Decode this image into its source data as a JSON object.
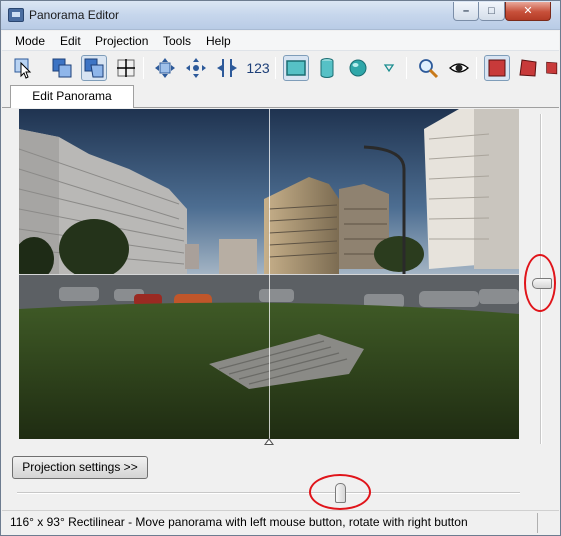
{
  "window": {
    "title": "Panorama Editor"
  },
  "menu": {
    "items": [
      "Mode",
      "Edit",
      "Projection",
      "Tools",
      "Help"
    ]
  },
  "toolbar": {
    "buttons": [
      {
        "icon": "select-arrow-icon"
      },
      {
        "icon": "overlapping-frames-icon"
      },
      {
        "icon": "overlapping-frames-selected-icon",
        "pressed": true
      },
      {
        "icon": "crosshair-icon"
      },
      {
        "icon": "move-all-directions-icon"
      },
      {
        "icon": "move-center-icon"
      },
      {
        "icon": "compress-horizontal-icon"
      },
      {
        "icon": "numbering-icon",
        "label": "123"
      },
      {
        "icon": "rectilinear-projection-icon",
        "pressed": true
      },
      {
        "icon": "cylinder-projection-icon"
      },
      {
        "icon": "sphere-projection-icon"
      },
      {
        "icon": "dropdown-triangle-icon"
      },
      {
        "icon": "zoom-icon"
      },
      {
        "icon": "eye-icon"
      },
      {
        "icon": "frame-red-square-icon",
        "pressed": true
      },
      {
        "icon": "frame-red-skew-icon"
      },
      {
        "icon": "frame-red-partial-icon"
      }
    ]
  },
  "tabs": [
    {
      "label": "Edit Panorama",
      "active": true
    }
  ],
  "projection_button": {
    "label": "Projection settings >>"
  },
  "status": {
    "text": "116° x 93° Rectilinear - Move panorama with left mouse button, rotate with right button"
  },
  "sliders": {
    "vertical": {
      "position_fraction": 0.51
    },
    "horizontal": {
      "position_fraction": 0.64
    }
  },
  "colors": {
    "annotation": "#e0141a",
    "accent": "#3a6ea5"
  }
}
